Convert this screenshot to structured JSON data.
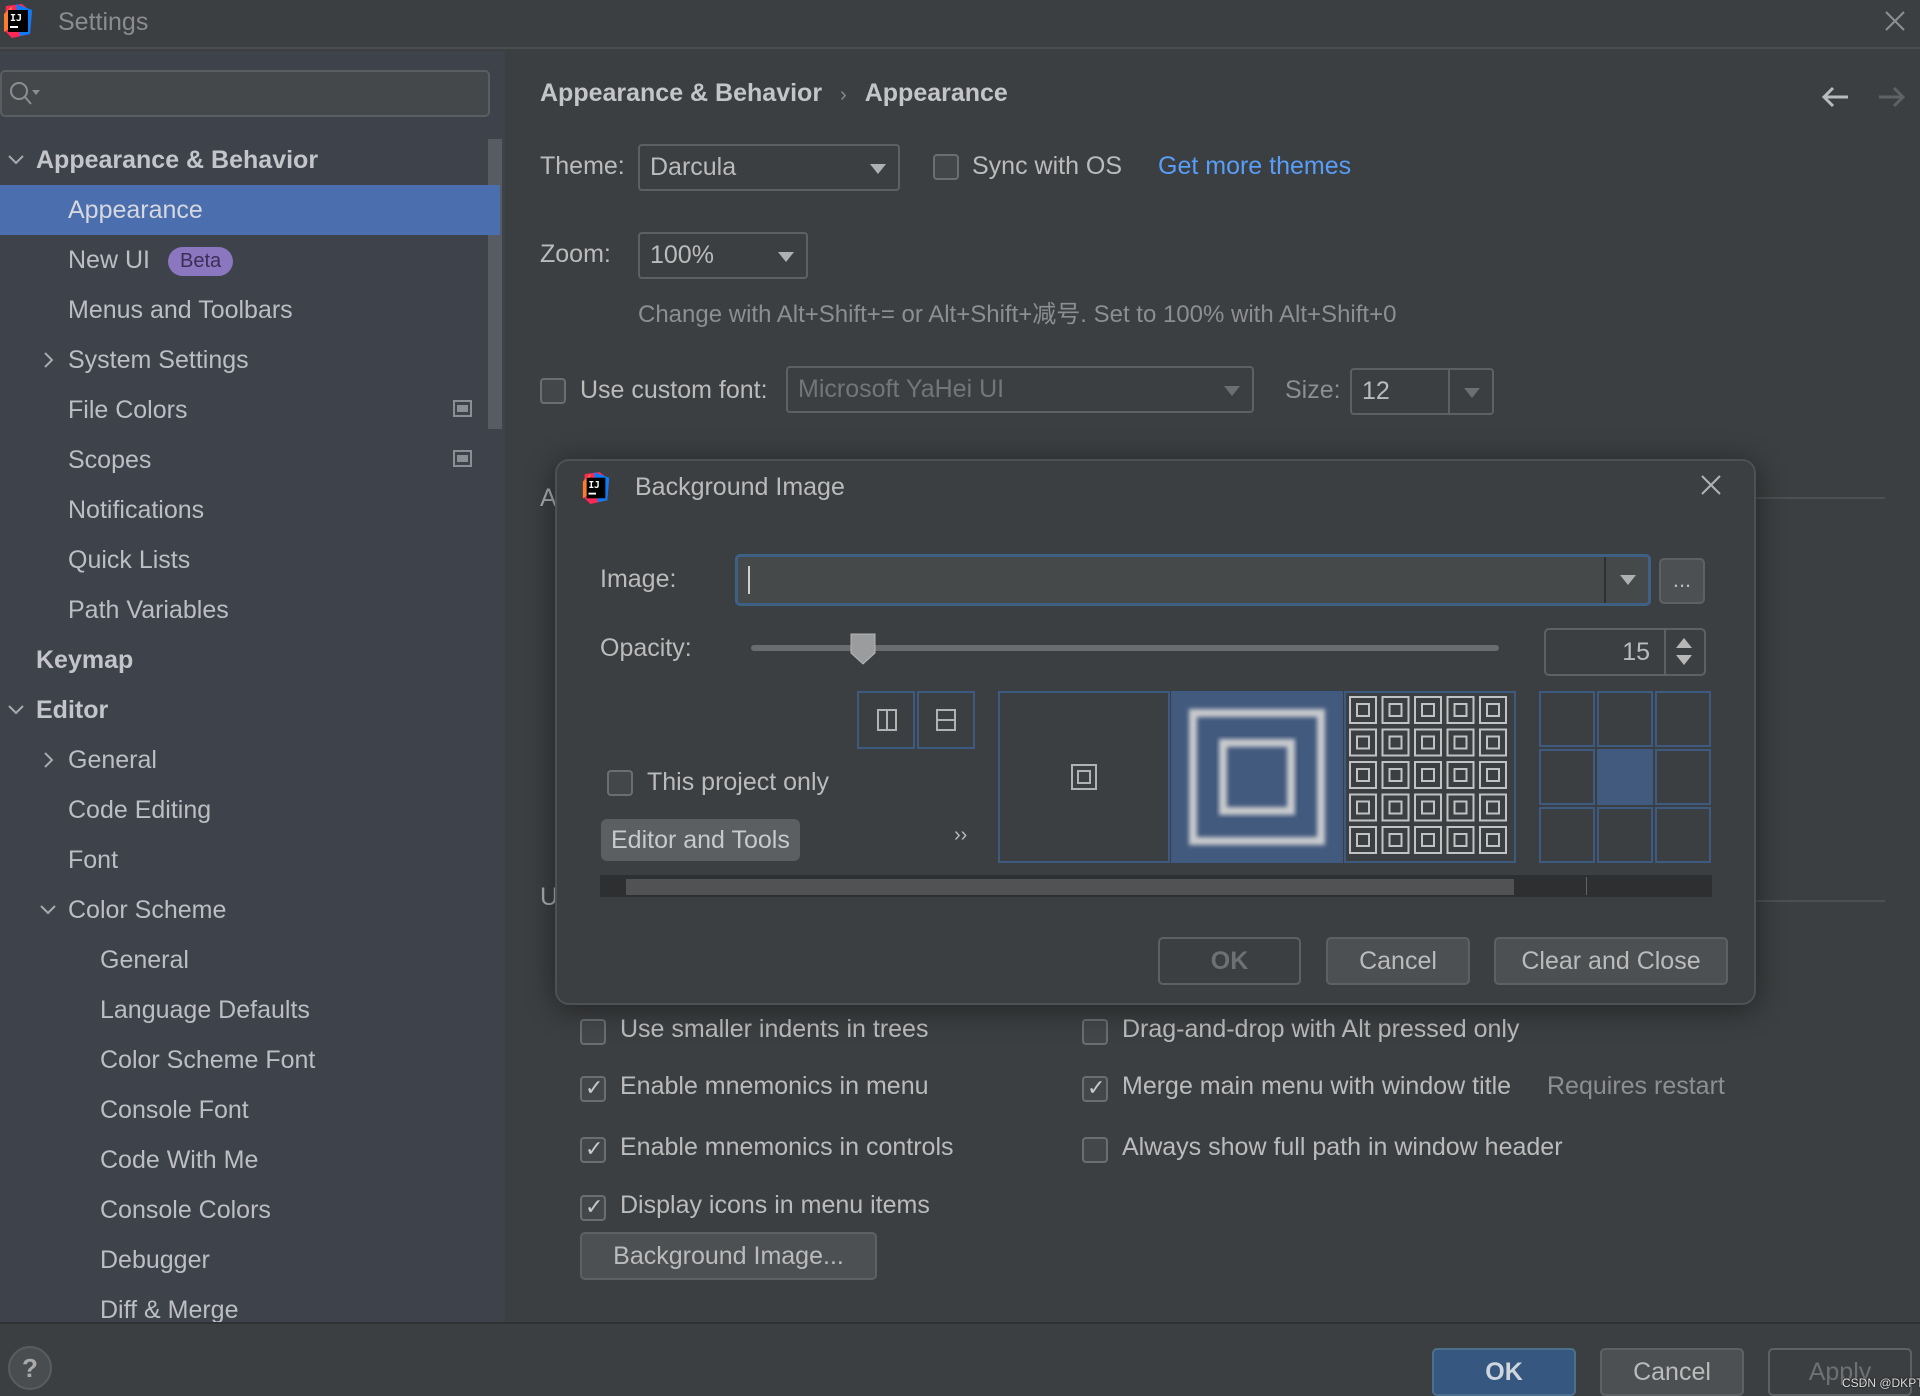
{
  "window": {
    "title": "Settings",
    "app_icon": "intellij-idea-logo"
  },
  "search": {
    "placeholder": "",
    "value": ""
  },
  "sidebar": {
    "items": [
      {
        "label": "Appearance & Behavior",
        "level": 0,
        "expanded": true,
        "bold": true
      },
      {
        "label": "Appearance",
        "level": 1,
        "selected": true
      },
      {
        "label": "New UI",
        "level": 1,
        "badge": "Beta"
      },
      {
        "label": "Menus and Toolbars",
        "level": 1
      },
      {
        "label": "System Settings",
        "level": 1,
        "expandable": true
      },
      {
        "label": "File Colors",
        "level": 1,
        "project_icon": true
      },
      {
        "label": "Scopes",
        "level": 1,
        "project_icon": true
      },
      {
        "label": "Notifications",
        "level": 1
      },
      {
        "label": "Quick Lists",
        "level": 1
      },
      {
        "label": "Path Variables",
        "level": 1
      },
      {
        "label": "Keymap",
        "level": 0,
        "bold": true
      },
      {
        "label": "Editor",
        "level": 0,
        "expanded": true,
        "bold": true
      },
      {
        "label": "General",
        "level": 1,
        "expandable": true
      },
      {
        "label": "Code Editing",
        "level": 1
      },
      {
        "label": "Font",
        "level": 1
      },
      {
        "label": "Color Scheme",
        "level": 1,
        "expanded": true
      },
      {
        "label": "General",
        "level": 2
      },
      {
        "label": "Language Defaults",
        "level": 2
      },
      {
        "label": "Color Scheme Font",
        "level": 2
      },
      {
        "label": "Console Font",
        "level": 2
      },
      {
        "label": "Code With Me",
        "level": 2
      },
      {
        "label": "Console Colors",
        "level": 2
      },
      {
        "label": "Debugger",
        "level": 2
      },
      {
        "label": "Diff & Merge",
        "level": 2
      }
    ]
  },
  "main": {
    "breadcrumb": [
      "Appearance & Behavior",
      "Appearance"
    ],
    "breadcrumb_separator": "›",
    "theme": {
      "label": "Theme:",
      "value": "Darcula"
    },
    "sync_os": {
      "label": "Sync with OS",
      "checked": false
    },
    "get_more_themes": "Get more themes",
    "zoom": {
      "label": "Zoom:",
      "value": "100%"
    },
    "zoom_hint": "Change with Alt+Shift+= or Alt+Shift+减号. Set to 100% with Alt+Shift+0",
    "custom_font": {
      "label": "Use custom font:",
      "checked": false,
      "value": "Microsoft YaHei UI"
    },
    "size": {
      "label": "Size:",
      "value": "12"
    },
    "hidden_section_initial_1": "A",
    "hidden_section_initial_2": "U",
    "options_left": [
      {
        "label": "Use smaller indents in trees",
        "checked": false
      },
      {
        "label": "Enable mnemonics in menu",
        "checked": true
      },
      {
        "label": "Enable mnemonics in controls",
        "checked": true
      },
      {
        "label": "Display icons in menu items",
        "checked": true
      }
    ],
    "options_right": [
      {
        "label": "Drag-and-drop with Alt pressed only",
        "checked": false
      },
      {
        "label": "Merge main menu with window title",
        "checked": true,
        "note": "Requires restart"
      },
      {
        "label": "Always show full path in window header",
        "checked": false
      }
    ],
    "background_image_button": "Background Image..."
  },
  "dialog": {
    "title": "Background Image",
    "image_label": "Image:",
    "image_value": "",
    "browse_label": "...",
    "opacity_label": "Opacity:",
    "opacity_value": "15",
    "opacity_percent": 15,
    "this_project_only": {
      "label": "This project only",
      "checked": false
    },
    "target_button": "Editor and Tools",
    "more_glyph": "››",
    "fill_options": [
      "center",
      "scale",
      "tile"
    ],
    "fill_selected": "scale",
    "anchor_selected": "center",
    "buttons": {
      "ok": "OK",
      "cancel": "Cancel",
      "clear_close": "Clear and Close"
    }
  },
  "footer": {
    "help": "?",
    "ok": "OK",
    "cancel": "Cancel",
    "apply": "Apply",
    "watermark": "CSDN @DKPT"
  },
  "colors": {
    "selection": "#4b6eaf",
    "link": "#589df6",
    "primary_button": "#365880",
    "beta_badge": "#8b77c0",
    "focus_border": "#3d6185"
  }
}
